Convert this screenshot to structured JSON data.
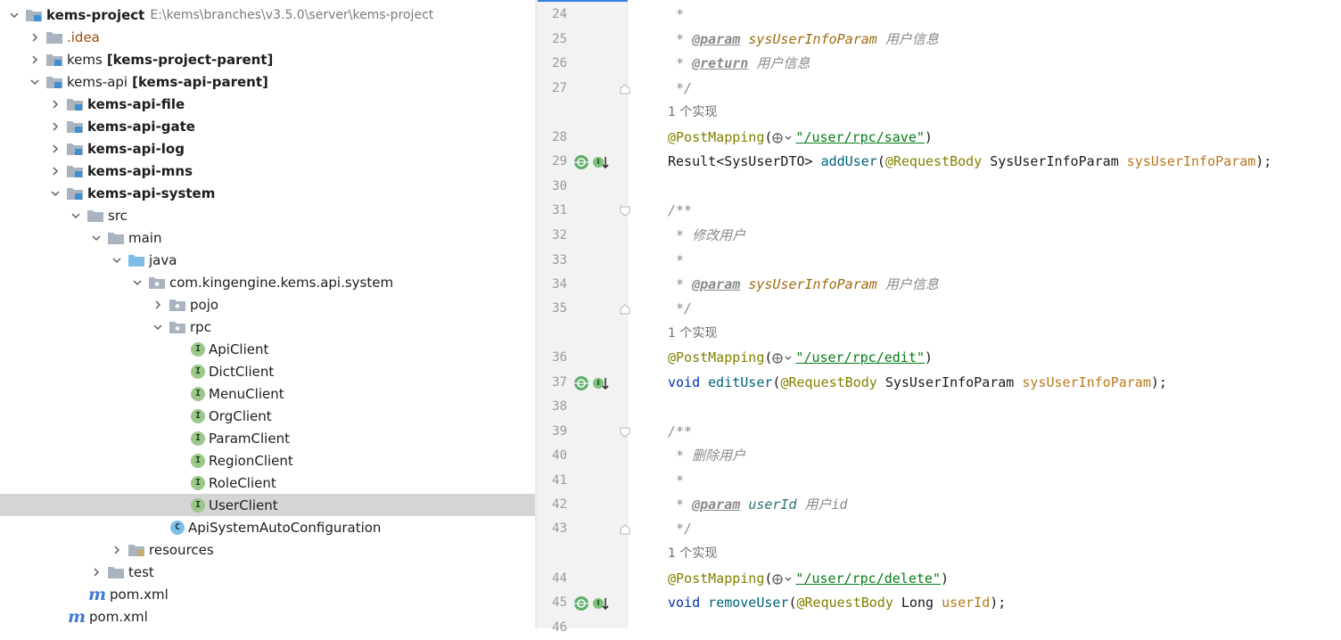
{
  "tree": {
    "root": {
      "name": "kems-project",
      "path": "E:\\kems\\branches\\v3.5.0\\server\\kems-project"
    },
    "idea": ".idea",
    "kems": {
      "name": "kems",
      "module": "[kems-project-parent]"
    },
    "kems_api": {
      "name": "kems-api",
      "module": "[kems-api-parent]"
    },
    "modules": [
      "kems-api-file",
      "kems-api-gate",
      "kems-api-log",
      "kems-api-mns",
      "kems-api-system"
    ],
    "src": "src",
    "main": "main",
    "java": "java",
    "package": "com.kingengine.kems.api.system",
    "pojo": "pojo",
    "rpc": "rpc",
    "clients": [
      "ApiClient",
      "DictClient",
      "MenuClient",
      "OrgClient",
      "ParamClient",
      "RegionClient",
      "RoleClient",
      "UserClient"
    ],
    "autoconfig": "ApiSystemAutoConfiguration",
    "resources": "resources",
    "test": "test",
    "pom_inner": "pom.xml",
    "pom_outer": "pom.xml",
    "interface_letter": "I",
    "class_letter": "C"
  },
  "editor": {
    "line_numbers": [
      "24",
      "25",
      "26",
      "27",
      "28",
      "29",
      "30",
      "31",
      "32",
      "33",
      "34",
      "35",
      "36",
      "37",
      "38",
      "39",
      "40",
      "41",
      "42",
      "43",
      "44",
      "45",
      "46"
    ],
    "impl_hint": "1 个实现",
    "star": "*",
    "open_doc": "/**",
    "close_doc": "*/",
    "tag_param": "@param",
    "tag_return": "@return",
    "param_name": "sysUserInfoParam",
    "param_desc": "用户信息",
    "return_desc": "用户信息",
    "edit_desc": "修改用户",
    "delete_desc": "删除用户",
    "user_id": "userId",
    "user_id_desc": "用户id",
    "annotation": "@PostMapping",
    "paren_open": "(",
    "paren_close": ")",
    "quote": "\"",
    "url_save": "/user/rpc/save",
    "url_edit": "/user/rpc/edit",
    "url_delete": "/user/rpc/delete",
    "result_type": "Result",
    "generic": "<SysUserDTO>",
    "add_user": "addUser",
    "request_body": "@RequestBody",
    "param_type": "SysUserInfoParam",
    "semicolon": ");",
    "void": "void",
    "edit_user": "editUser",
    "remove_user": "removeUser",
    "long_type": "Long"
  }
}
